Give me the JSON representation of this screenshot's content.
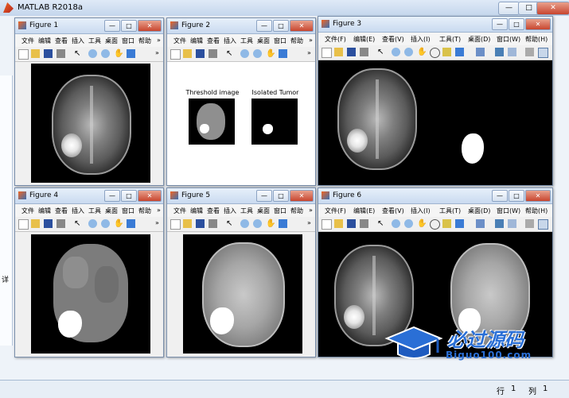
{
  "app": {
    "title": "MATLAB R2018a"
  },
  "statusbar": {
    "row_label": "行",
    "row_value": "1",
    "col_label": "列",
    "col_value": "1"
  },
  "menu_short": [
    "文件",
    "编辑",
    "查看",
    "插入",
    "工具",
    "桌面",
    "窗口",
    "帮助"
  ],
  "menu_long": [
    "文件(F)",
    "编辑(E)",
    "查看(V)",
    "插入(I)",
    "工具(T)",
    "桌面(D)",
    "窗口(W)",
    "帮助(H)"
  ],
  "figures": {
    "f1": {
      "title": "Figure 1"
    },
    "f2": {
      "title": "Figure 2",
      "caption_left": "Threshold image",
      "caption_right": "Isolated Tumor"
    },
    "f3": {
      "title": "Figure 3"
    },
    "f4": {
      "title": "Figure 4"
    },
    "f5": {
      "title": "Figure 5"
    },
    "f6": {
      "title": "Figure 6"
    }
  },
  "watermark": {
    "cn": "必过源码",
    "en": "Biguo100.com"
  },
  "left_panel_char": "详"
}
